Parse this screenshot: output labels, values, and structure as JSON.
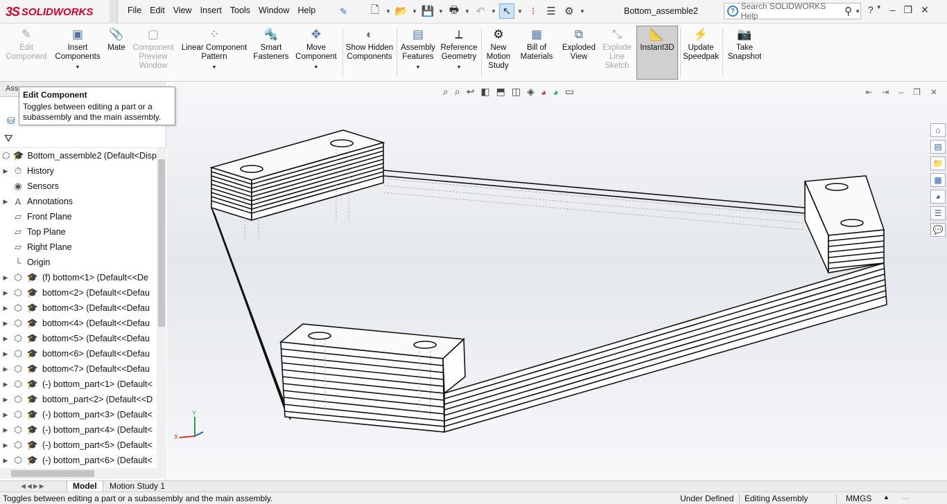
{
  "titlebar": {
    "logo_ds": "3S",
    "logo_text": "SOLIDWORKS",
    "menus": [
      "File",
      "Edit",
      "View",
      "Insert",
      "Tools",
      "Window",
      "Help"
    ],
    "document_title": "Bottom_assemble2",
    "search_placeholder": "Search SOLIDWORKS Help"
  },
  "ribbon": {
    "edit_component": "Edit Component",
    "insert_components": "Insert Components",
    "mate": "Mate",
    "component_preview": "Component Preview Window",
    "linear_pattern": "Linear Component Pattern",
    "smart_fasteners": "Smart Fasteners",
    "move_component": "Move Component",
    "show_hidden": "Show Hidden Components",
    "assembly_features": "Assembly Features",
    "reference_geometry": "Reference Geometry",
    "new_motion_study": "New Motion Study",
    "bill_of_materials": "Bill of Materials",
    "exploded_view": "Exploded View",
    "explode_line_sketch": "Explode Line Sketch",
    "instant3d": "Instant3D",
    "update_speedpak": "Update Speedpak",
    "take_snapshot": "Take Snapshot"
  },
  "tabs": {
    "assembly": "Ass"
  },
  "tooltip": {
    "title": "Edit Component",
    "description": "Toggles between editing a part or a subassembly and the main assembly."
  },
  "tree": {
    "root": "Bottom_assemble2  (Default<Disp",
    "items": [
      {
        "label": "History"
      },
      {
        "label": "Sensors"
      },
      {
        "label": "Annotations"
      },
      {
        "label": "Front Plane"
      },
      {
        "label": "Top Plane"
      },
      {
        "label": "Right Plane"
      },
      {
        "label": "Origin"
      },
      {
        "label": "(f) bottom<1>  (Default<<De"
      },
      {
        "label": "bottom<2>  (Default<<Defau"
      },
      {
        "label": "bottom<3>  (Default<<Defau"
      },
      {
        "label": "bottom<4>  (Default<<Defau"
      },
      {
        "label": "bottom<5>  (Default<<Defau"
      },
      {
        "label": "bottom<6>  (Default<<Defau"
      },
      {
        "label": "bottom<7>  (Default<<Defau"
      },
      {
        "label": "(-) bottom_part<1>  (Default<"
      },
      {
        "label": "bottom_part<2>  (Default<<D"
      },
      {
        "label": "(-) bottom_part<3>  (Default<"
      },
      {
        "label": "(-) bottom_part<4>  (Default<"
      },
      {
        "label": "(-) bottom_part<5>  (Default<"
      },
      {
        "label": "(-) bottom_part<6>  (Default<"
      }
    ]
  },
  "triad": {
    "y": "Y",
    "x": "X"
  },
  "bottom_tabs": {
    "model": "Model",
    "motion_study": "Motion Study 1"
  },
  "status": {
    "message": "Toggles between editing a part or a subassembly and the main assembly.",
    "definition": "Under Defined",
    "mode": "Editing Assembly",
    "units": "MMGS"
  }
}
